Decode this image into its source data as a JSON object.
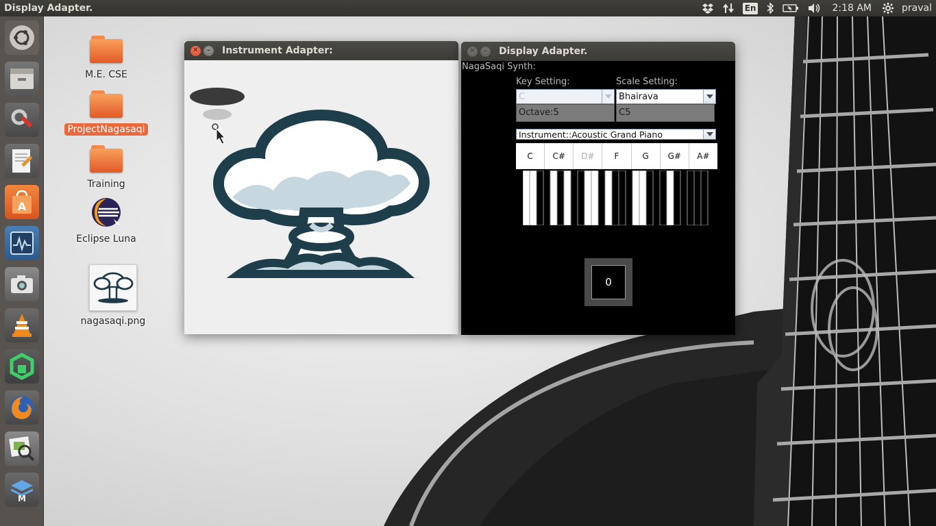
{
  "top_panel": {
    "active_title": "Display Adapter.",
    "language": "En",
    "clock": "2:18 AM",
    "user": "praval"
  },
  "launcher": {
    "items": [
      "ubuntu-dash",
      "file-manager",
      "system-settings",
      "text-editor",
      "software-center",
      "system-monitor",
      "screenshot",
      "vlc",
      "app",
      "firefox",
      "image-viewer",
      "workspace-switcher"
    ]
  },
  "desktop": {
    "icons": [
      {
        "label": "M.E. CSE",
        "type": "folder"
      },
      {
        "label": "ProjectNagasaqi",
        "type": "folder",
        "selected": true
      },
      {
        "label": "Training",
        "type": "folder"
      },
      {
        "label": "Eclipse Luna",
        "type": "app"
      },
      {
        "label": "nagasaqi.png",
        "type": "image"
      }
    ]
  },
  "instrument_window": {
    "title": "Instrument Adapter:"
  },
  "display_window": {
    "title": "Display Adapter.",
    "synth_label": "NagaSaqi Synth:",
    "key_setting_label": "Key Setting:",
    "key_value": "C",
    "scale_setting_label": "Scale Setting:",
    "scale_value": "Bhairava",
    "octave_field": "Octave:5",
    "note_field": "C5",
    "instrument_value": "Instrument::Acoustic Grand Piano",
    "notes": [
      {
        "label": "C",
        "dim": false
      },
      {
        "label": "C#",
        "dim": false
      },
      {
        "label": "D#",
        "dim": true
      },
      {
        "label": "F",
        "dim": false
      },
      {
        "label": "G",
        "dim": false
      },
      {
        "label": "G#",
        "dim": false
      },
      {
        "label": "A#",
        "dim": false
      }
    ],
    "counter": "0"
  },
  "colors": {
    "accent": "#e9683c",
    "panel": "#3c3b37",
    "close_button": "#e05a3a"
  }
}
